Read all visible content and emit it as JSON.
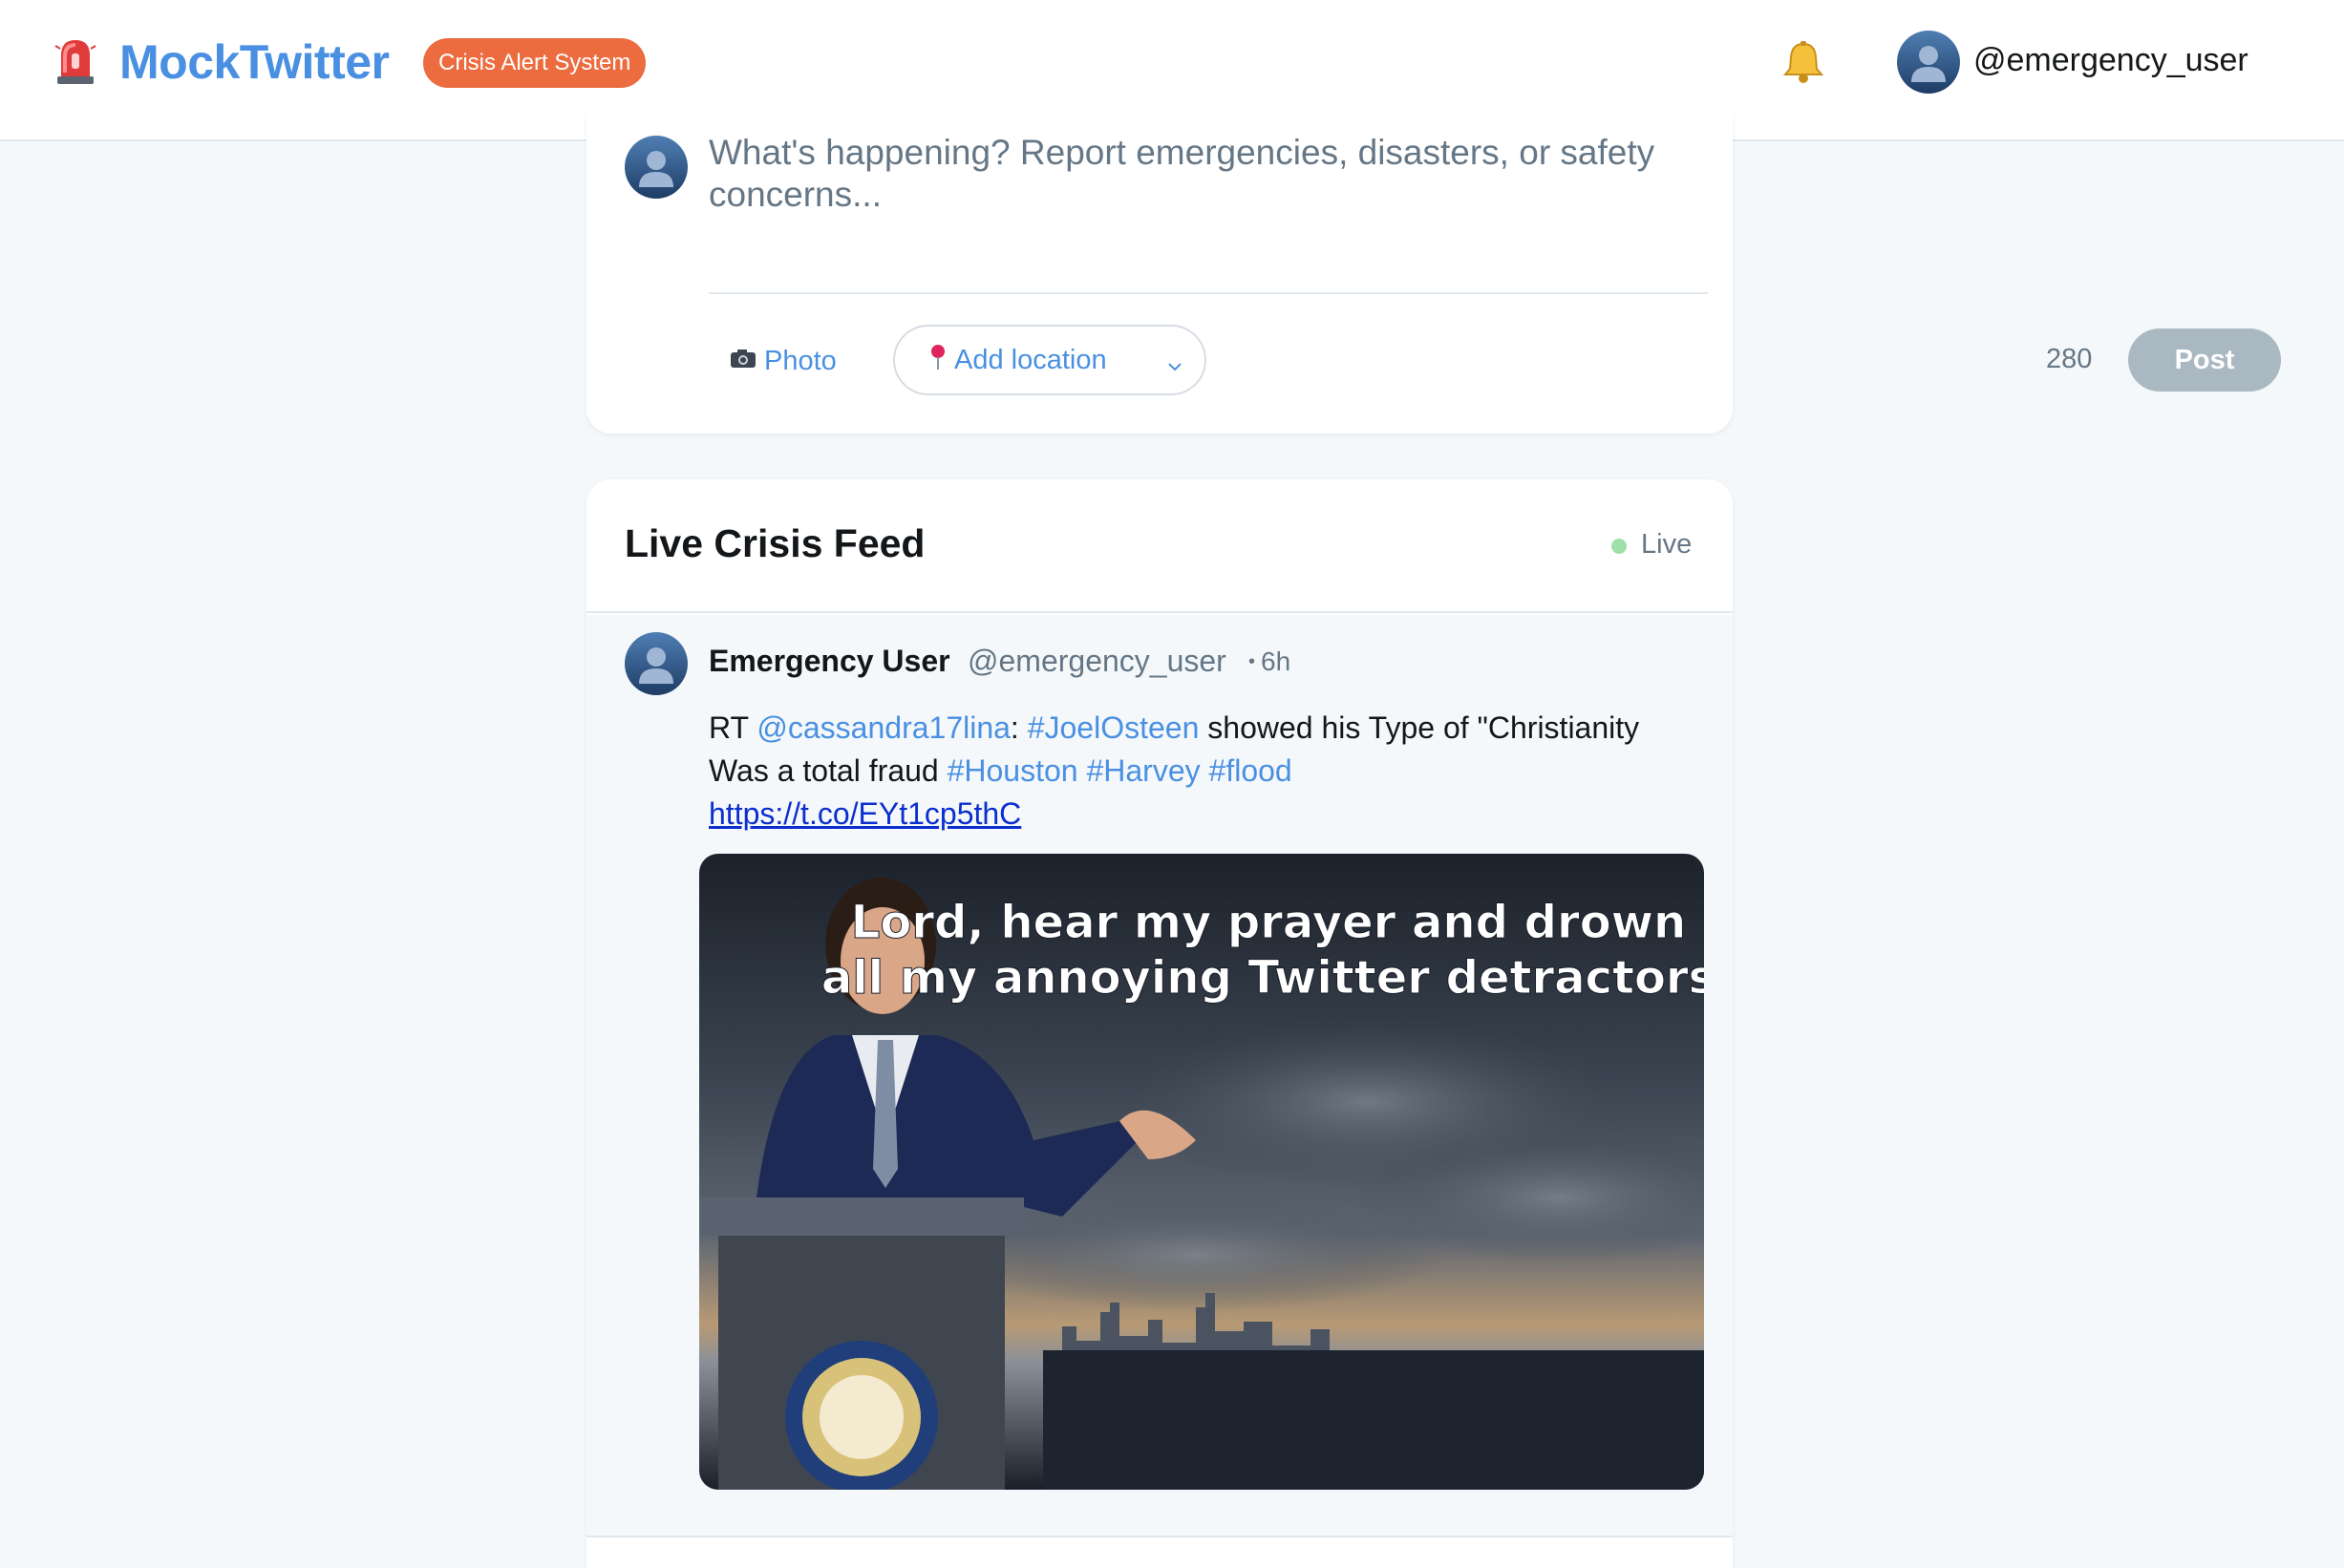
{
  "header": {
    "logo_icon": "siren-icon",
    "brand": "MockTwitter",
    "badge": "Crisis Alert System",
    "notification_icon": "bell-icon",
    "user_handle": "@emergency_user"
  },
  "compose": {
    "placeholder": "What's happening? Report emergencies, disasters, or safety concerns...",
    "photo_icon": "camera-icon",
    "photo_label": "Photo",
    "location_icon": "pin-icon",
    "location_label": "Add location",
    "char_count": "280",
    "post_label": "Post"
  },
  "feed": {
    "title": "Live Crisis Feed",
    "live_label": "Live",
    "tweets": [
      {
        "name": "Emergency User",
        "handle": "@emergency_user",
        "time": "6h",
        "text_prefix": "RT ",
        "mention": "@cassandra17lina",
        "colon": ":",
        "tag1": "#JoelOsteen",
        "text_middle": " showed his Type of \"Christianity Was a total fraud ",
        "tag2": "#Houston",
        "tag3": "#Harvey",
        "tag4": "#flood",
        "url": "https://t.co/EYt1cp5thC",
        "image_caption_line1": "Lord, hear my prayer and drown",
        "image_caption_line2": "all my annoying Twitter detractors"
      }
    ]
  },
  "colors": {
    "brand": "#4a90e2",
    "badge": "#ec6b3f",
    "live": "#9ee0a8",
    "post_disabled": "#aab8c2"
  }
}
